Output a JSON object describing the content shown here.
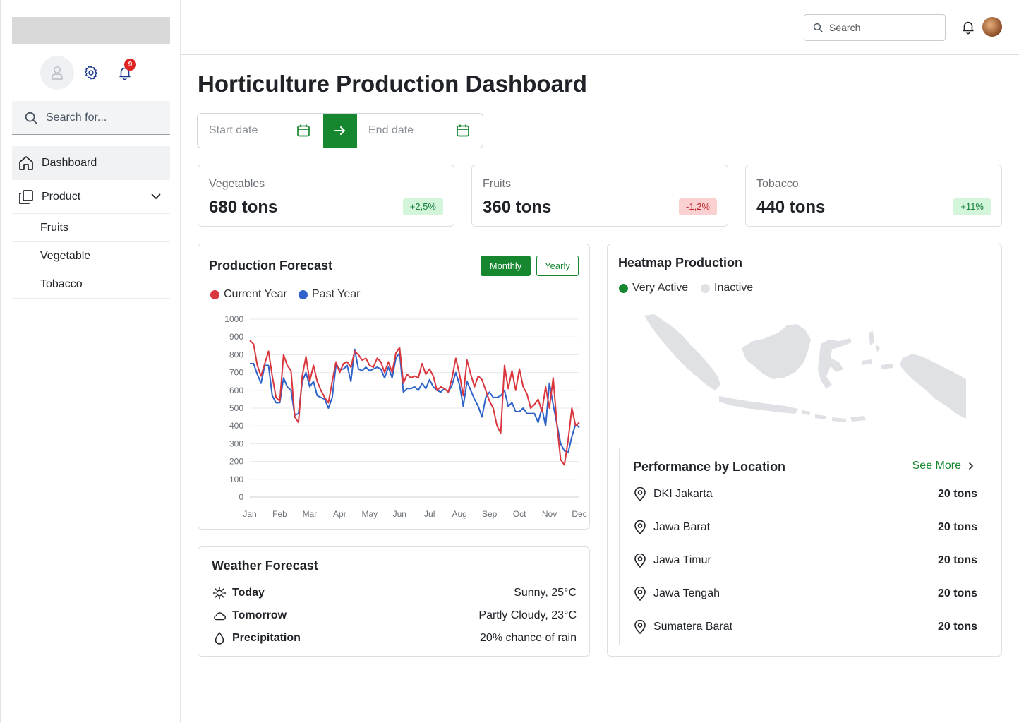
{
  "sidebar": {
    "notif_count": "9",
    "search_placeholder": "Search for...",
    "nav": [
      {
        "label": "Dashboard"
      },
      {
        "label": "Product"
      }
    ],
    "sub_items": [
      {
        "label": "Fruits"
      },
      {
        "label": "Vegetable"
      },
      {
        "label": "Tobacco"
      }
    ]
  },
  "topbar": {
    "search_placeholder": "Search"
  },
  "page": {
    "title": "Horticulture Production Dashboard"
  },
  "daterange": {
    "start_placeholder": "Start date",
    "end_placeholder": "End date"
  },
  "stats": [
    {
      "label": "Vegetables",
      "value": "680 tons",
      "change": "+2,5%",
      "trend": "up"
    },
    {
      "label": "Fruits",
      "value": "360 tons",
      "change": "-1,2%",
      "trend": "down"
    },
    {
      "label": "Tobacco",
      "value": "440 tons",
      "change": "+11%",
      "trend": "up"
    }
  ],
  "forecast": {
    "title": "Production Forecast",
    "toggle_monthly": "Monthly",
    "toggle_yearly": "Yearly",
    "legend_current": "Current Year",
    "legend_past": "Past Year"
  },
  "chart_data": {
    "type": "line",
    "categories": [
      "Jan",
      "Feb",
      "Mar",
      "Apr",
      "May",
      "Jun",
      "Jul",
      "Aug",
      "Sep",
      "Oct",
      "Nov",
      "Dec"
    ],
    "ylim": [
      0,
      1000
    ],
    "yticks": [
      0,
      100,
      200,
      300,
      400,
      500,
      600,
      700,
      800,
      900,
      1000
    ],
    "grid": true,
    "colors": {
      "current": "#d9363e",
      "past": "#2f63c9"
    },
    "series": [
      {
        "name": "Current Year",
        "values": [
          880,
          860,
          740,
          680,
          750,
          820,
          680,
          560,
          540,
          800,
          740,
          710,
          450,
          420,
          680,
          790,
          650,
          740,
          650,
          600,
          560,
          530,
          650,
          760,
          700,
          750,
          760,
          730,
          820,
          800,
          770,
          780,
          740,
          730,
          780,
          760,
          700,
          760,
          700,
          810,
          840,
          640,
          690,
          670,
          680,
          670,
          750,
          690,
          720,
          680,
          600,
          620,
          610,
          590,
          670,
          780,
          690,
          570,
          770,
          690,
          620,
          680,
          660,
          600,
          540,
          500,
          400,
          360,
          740,
          610,
          710,
          600,
          720,
          620,
          580,
          500,
          520,
          550,
          480,
          620,
          500,
          670,
          410,
          210,
          180,
          320,
          500,
          400,
          420
        ]
      },
      {
        "name": "Past Year",
        "values": [
          750,
          750,
          690,
          640,
          740,
          740,
          570,
          530,
          530,
          670,
          620,
          600,
          460,
          470,
          650,
          700,
          620,
          650,
          570,
          560,
          550,
          500,
          560,
          740,
          720,
          720,
          740,
          650,
          830,
          720,
          710,
          730,
          710,
          720,
          730,
          720,
          670,
          730,
          670,
          780,
          810,
          590,
          610,
          610,
          620,
          600,
          640,
          610,
          660,
          620,
          600,
          590,
          610,
          590,
          630,
          700,
          630,
          510,
          650,
          600,
          550,
          510,
          450,
          560,
          590,
          560,
          560,
          570,
          600,
          510,
          530,
          480,
          480,
          500,
          470,
          470,
          470,
          420,
          500,
          400,
          640,
          520,
          410,
          300,
          260,
          250,
          340,
          410,
          390
        ]
      }
    ]
  },
  "weather": {
    "title": "Weather Forecast",
    "rows": [
      {
        "label": "Today",
        "value": "Sunny, 25°C",
        "icon": "sun-icon"
      },
      {
        "label": "Tomorrow",
        "value": "Partly Cloudy, 23°C",
        "icon": "cloud-icon"
      },
      {
        "label": "Precipitation",
        "value": "20% chance of rain",
        "icon": "droplet-icon"
      }
    ]
  },
  "heatmap": {
    "title": "Heatmap Production",
    "legend_active": "Very Active",
    "legend_inactive": "Inactive",
    "colors": {
      "active": "#16872f",
      "inactive": "#dfe1e5"
    }
  },
  "performance": {
    "title": "Performance by Location",
    "see_more": "See More",
    "rows": [
      {
        "location": "DKI Jakarta",
        "value": "20 tons"
      },
      {
        "location": "Jawa Barat",
        "value": "20 tons"
      },
      {
        "location": "Jawa Timur",
        "value": "20 tons"
      },
      {
        "location": "Jawa Tengah",
        "value": "20 tons"
      },
      {
        "location": "Sumatera Barat",
        "value": "20 tons"
      }
    ]
  }
}
